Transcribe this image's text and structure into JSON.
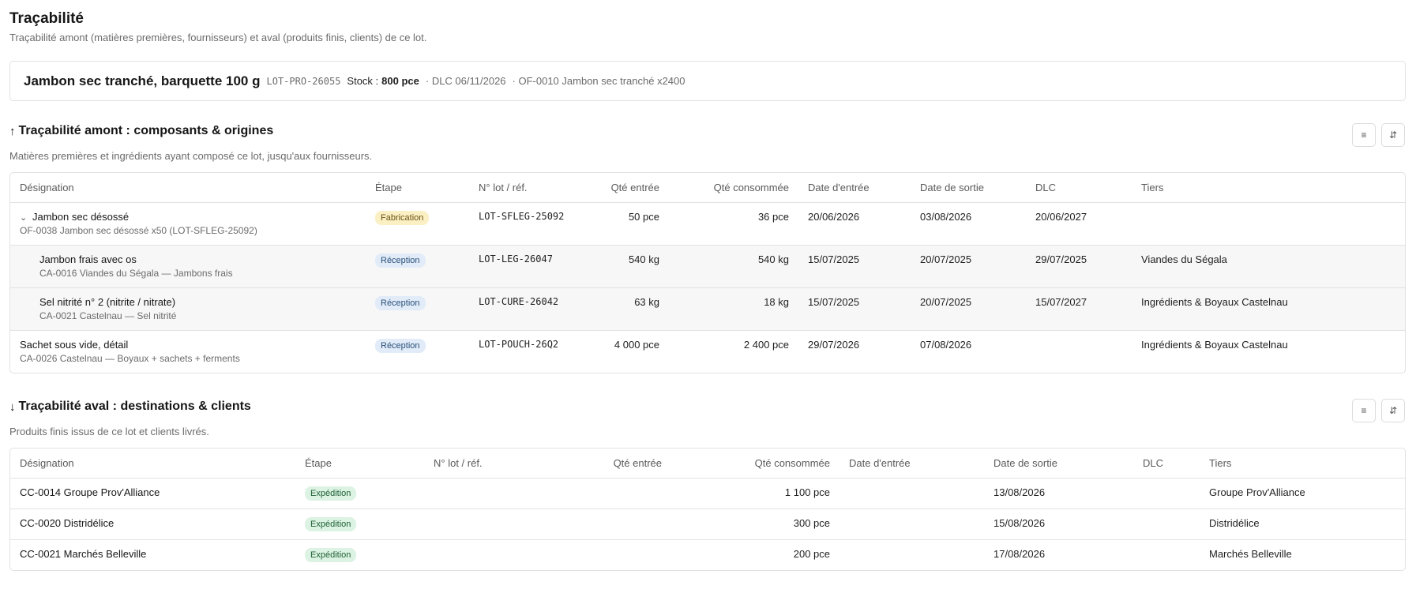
{
  "header": {
    "title": "Traçabilité",
    "subtitle": "Traçabilité amont (matières premières, fournisseurs) et aval (produits finis, clients) de ce lot."
  },
  "lot": {
    "name": "Jambon sec tranché, barquette 100 g",
    "code": "LOT-PRO-26055",
    "stock_label": "Stock :",
    "stock_value": "800 pce",
    "dlc": "· DLC 06/11/2026",
    "of": "· OF-0010 Jambon sec tranché x2400"
  },
  "upstream": {
    "title": "Traçabilité amont : composants & origines",
    "subtitle": "Matières premières et ingrédients ayant composé ce lot, jusqu'aux fournisseurs.",
    "columns": [
      "Désignation",
      "Étape",
      "N° lot / réf.",
      "Qté entrée",
      "Qté consommée",
      "Date d'entrée",
      "Date de sortie",
      "DLC",
      "Tiers"
    ],
    "rows": [
      {
        "name": "Jambon sec désossé",
        "sub": "OF-0038 Jambon sec désossé x50 (LOT-SFLEG-25092)",
        "step": "Fabrication",
        "lot": "LOT-SFLEG-25092",
        "qty_in": "50 pce",
        "qty_used": "36 pce",
        "date_in": "20/06/2026",
        "date_out": "03/08/2026",
        "dlc": "20/06/2027",
        "party": ""
      },
      {
        "name": "Jambon frais avec os",
        "sub": "CA-0016 Viandes du Ségala — Jambons frais",
        "step": "Réception",
        "lot": "LOT-LEG-26047",
        "qty_in": "540 kg",
        "qty_used": "540 kg",
        "date_in": "15/07/2025",
        "date_out": "20/07/2025",
        "dlc": "29/07/2025",
        "party": "Viandes du Ségala"
      },
      {
        "name": "Sel nitrité n° 2 (nitrite / nitrate)",
        "sub": "CA-0021 Castelnau — Sel nitrité",
        "step": "Réception",
        "lot": "LOT-CURE-26042",
        "qty_in": "63 kg",
        "qty_used": "18 kg",
        "date_in": "15/07/2025",
        "date_out": "20/07/2025",
        "dlc": "15/07/2027",
        "party": "Ingrédients & Boyaux Castelnau"
      },
      {
        "name": "Sachet sous vide, détail",
        "sub": "CA-0026 Castelnau — Boyaux + sachets + ferments",
        "step": "Réception",
        "lot": "LOT-POUCH-26Q2",
        "qty_in": "4 000 pce",
        "qty_used": "2 400 pce",
        "date_in": "29/07/2026",
        "date_out": "07/08/2026",
        "dlc": "",
        "party": "Ingrédients & Boyaux Castelnau"
      }
    ]
  },
  "downstream": {
    "title": "Traçabilité aval : destinations & clients",
    "subtitle": "Produits finis issus de ce lot et clients livrés.",
    "columns": [
      "Désignation",
      "Étape",
      "N° lot / réf.",
      "Qté entrée",
      "Qté consommée",
      "Date d'entrée",
      "Date de sortie",
      "DLC",
      "Tiers"
    ],
    "rows": [
      {
        "name": "CC-0014 Groupe Prov'Alliance",
        "step": "Expédition",
        "qty_used": "1 100 pce",
        "date_out": "13/08/2026",
        "party": "Groupe Prov'Alliance"
      },
      {
        "name": "CC-0020 Distridélice",
        "step": "Expédition",
        "qty_used": "300 pce",
        "date_out": "15/08/2026",
        "party": "Distridélice"
      },
      {
        "name": "CC-0021 Marchés Belleville",
        "step": "Expédition",
        "qty_used": "200 pce",
        "date_out": "17/08/2026",
        "party": "Marchés Belleville"
      }
    ]
  },
  "icons": {
    "list_view": "≡",
    "sort": "⇵",
    "chevron": "⌄",
    "arrow_up": "↑",
    "arrow_down": "↓"
  }
}
